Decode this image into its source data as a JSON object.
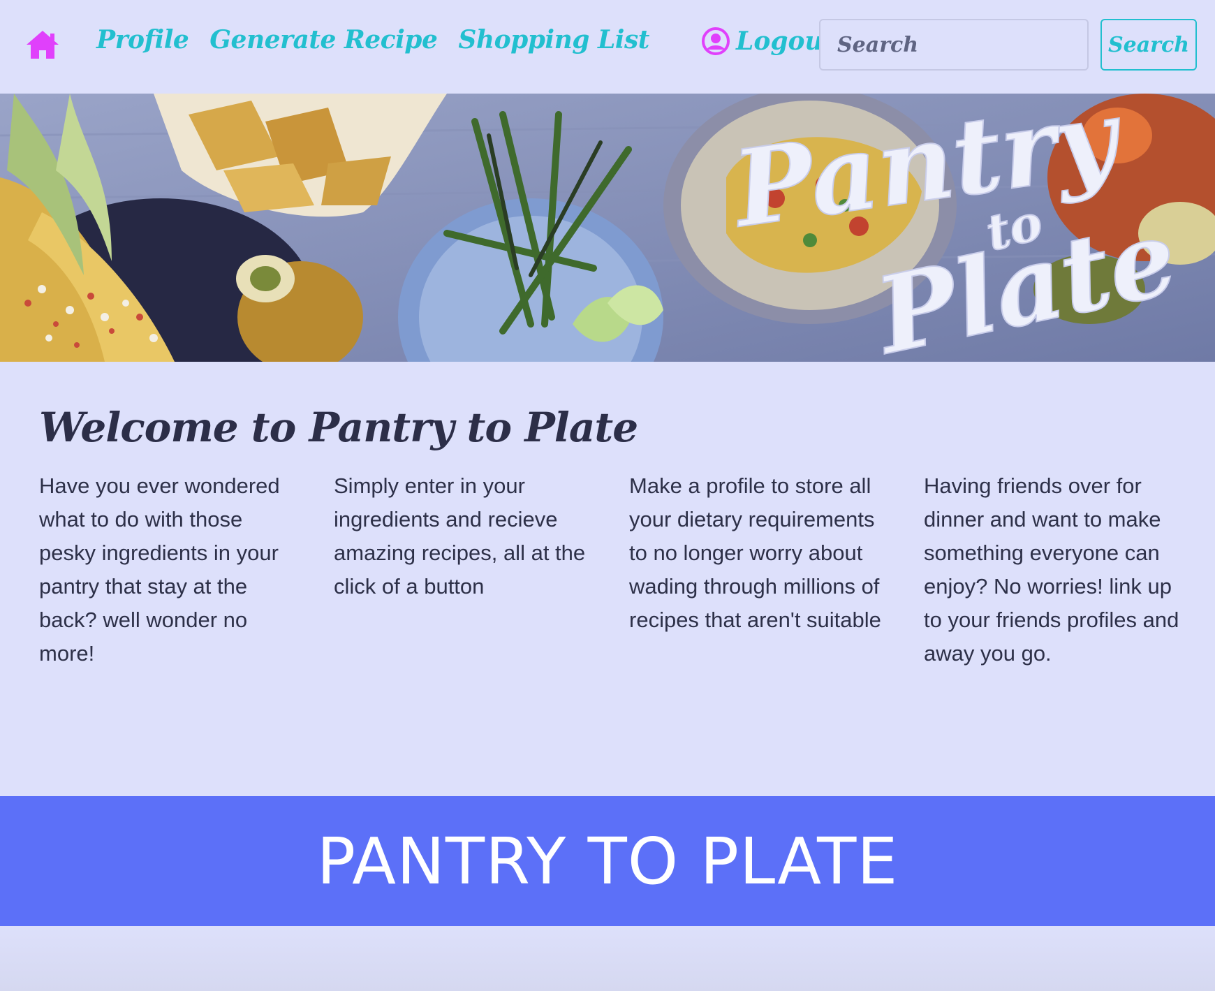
{
  "nav": {
    "home_icon": "home-icon",
    "links": [
      {
        "label": "Profile"
      },
      {
        "label": "Generate Recipe"
      },
      {
        "label": "Shopping List"
      }
    ],
    "logout_icon": "user-circle-icon",
    "logout_label": "Logout",
    "search_placeholder": "Search",
    "search_button_label": "Search"
  },
  "hero": {
    "title_main": "Pantry",
    "title_connector": "to",
    "title_end": "Plate"
  },
  "main": {
    "title": "Welcome to Pantry to Plate",
    "columns": [
      {
        "text": "Have you ever wondered what to do with those pesky ingredients in your pantry that stay at the back? well wonder no more!"
      },
      {
        "text": "Simply enter in your ingredients and recieve amazing recipes, all at the click of a button"
      },
      {
        "text": "Make a profile to store all your dietary requirements to no longer worry about wading through millions of recipes that aren't suitable"
      },
      {
        "text": "Having friends over for dinner and want to make something everyone can enjoy? No worries! link up to your friends profiles and away you go."
      }
    ]
  },
  "footer": {
    "title": "PANTRY TO PLATE"
  },
  "colors": {
    "background": "#dde0fb",
    "nav_link": "#22bfcf",
    "home_icon": "#e040fb",
    "heading": "#2c2e48",
    "footer_banner": "#5c70f8"
  }
}
